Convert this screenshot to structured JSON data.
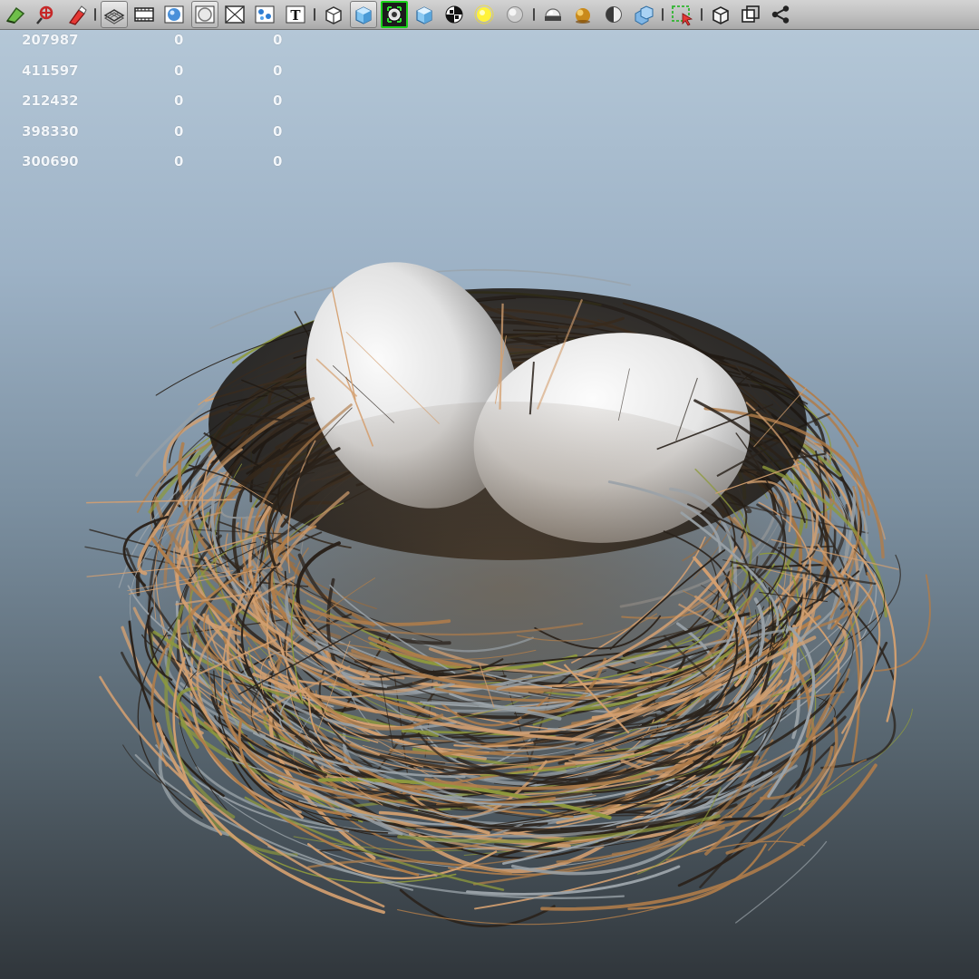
{
  "toolbar": {
    "buttons": [
      {
        "icon": "snap-together-icon"
      },
      {
        "icon": "soft-select-icon"
      },
      {
        "icon": "paint-effects-icon"
      },
      {
        "type": "separator"
      },
      {
        "icon": "grid-icon",
        "selected": true
      },
      {
        "icon": "film-gate-icon"
      },
      {
        "icon": "smooth-shade-icon"
      },
      {
        "icon": "circle-frame-icon",
        "selected": true
      },
      {
        "icon": "wireframe-box-icon"
      },
      {
        "icon": "texture-icon"
      },
      {
        "icon": "text-icon"
      },
      {
        "type": "separator"
      },
      {
        "icon": "wire-cube-icon"
      },
      {
        "icon": "shaded-cube-icon",
        "selected": true
      },
      {
        "icon": "isolate-select-icon",
        "selected_green": true
      },
      {
        "icon": "cube-icon"
      },
      {
        "icon": "checker-ball-icon"
      },
      {
        "icon": "light-bulb-icon"
      },
      {
        "icon": "gray-sphere-icon"
      },
      {
        "type": "separator"
      },
      {
        "icon": "dome-light-icon"
      },
      {
        "icon": "gold-sphere-icon"
      },
      {
        "icon": "half-sphere-icon"
      },
      {
        "icon": "blue-cubes-icon"
      },
      {
        "type": "separator"
      },
      {
        "icon": "select-region-icon"
      },
      {
        "type": "separator"
      },
      {
        "icon": "outline-cube-icon"
      },
      {
        "icon": "frame-all-icon"
      },
      {
        "icon": "share-icon"
      }
    ]
  },
  "hud": {
    "rows": [
      [
        "207987",
        "0",
        "0"
      ],
      [
        "411597",
        "0",
        "0"
      ],
      [
        "212432",
        "0",
        "0"
      ],
      [
        "398330",
        "0",
        "0"
      ],
      [
        "300690",
        "0",
        "0"
      ]
    ]
  },
  "scene": {
    "eggs": 2,
    "colors": {
      "egg": "#dedede",
      "straw_brown": "#b07d4a",
      "straw_light": "#d4a070",
      "twig_dark": "#2a221b",
      "grass_gray": "#9aa2a8",
      "grass_olive": "#8e9a3c"
    }
  }
}
